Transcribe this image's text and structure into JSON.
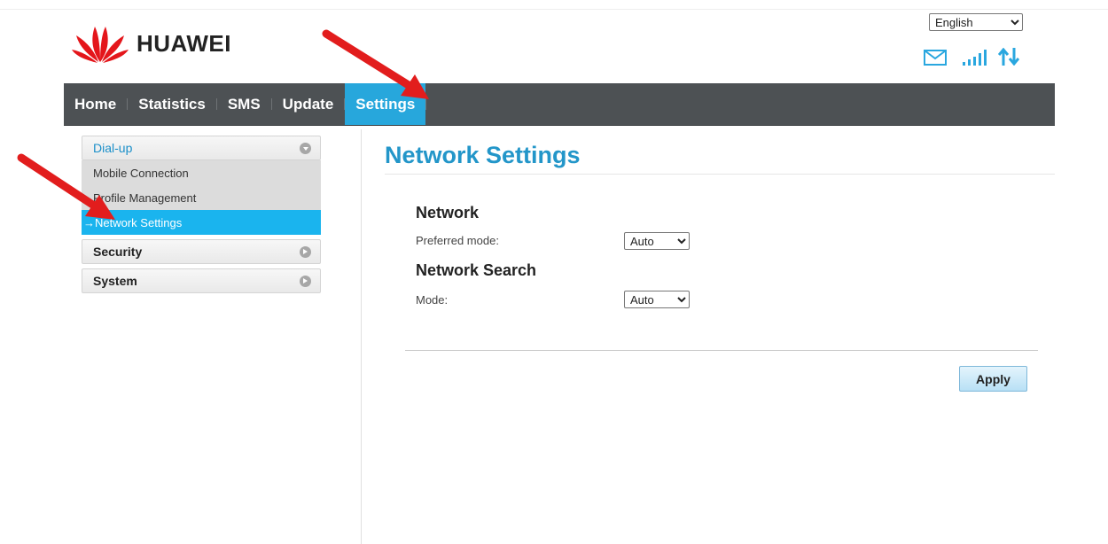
{
  "header": {
    "brand": "HUAWEI",
    "language": {
      "selected": "English",
      "options": [
        "English"
      ]
    },
    "status_icons": [
      "mail-icon",
      "signal-icon",
      "data-transfer-icon"
    ]
  },
  "nav": {
    "items": [
      {
        "label": "Home",
        "active": false
      },
      {
        "label": "Statistics",
        "active": false
      },
      {
        "label": "SMS",
        "active": false
      },
      {
        "label": "Update",
        "active": false
      },
      {
        "label": "Settings",
        "active": true
      }
    ]
  },
  "sidebar": {
    "groups": [
      {
        "label": "Dial-up",
        "expanded": true,
        "items": [
          {
            "label": "Mobile Connection",
            "active": false
          },
          {
            "label": "Profile Management",
            "active": false
          },
          {
            "label": "Network Settings",
            "active": true,
            "prefix": "→"
          }
        ]
      },
      {
        "label": "Security",
        "expanded": false
      },
      {
        "label": "System",
        "expanded": false
      }
    ]
  },
  "main": {
    "title": "Network Settings",
    "sections": [
      {
        "title": "Network",
        "field_label": "Preferred mode:",
        "value": "Auto",
        "options": [
          "Auto"
        ]
      },
      {
        "title": "Network Search",
        "field_label": "Mode:",
        "value": "Auto",
        "options": [
          "Auto"
        ]
      }
    ],
    "apply_label": "Apply"
  },
  "colors": {
    "nav_bg": "#4d5154",
    "accent": "#27a7dc",
    "sidebar_active": "#1ab4ee",
    "title_blue": "#2396c9",
    "annotation_arrow": "#e21d1d"
  }
}
